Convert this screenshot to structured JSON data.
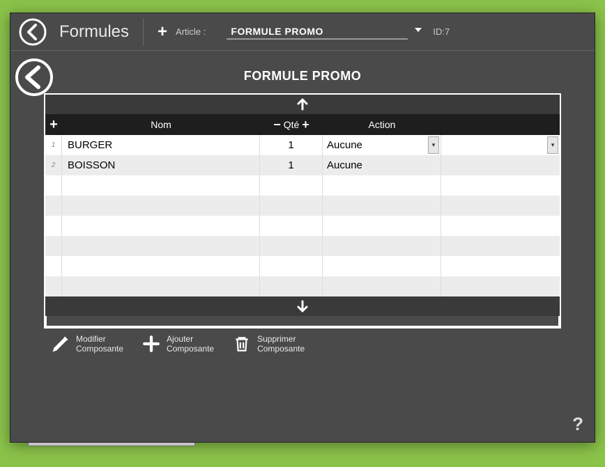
{
  "header": {
    "title": "Formules",
    "article_label": "Article :",
    "article_value": "FORMULE PROMO",
    "id_label": "ID:7"
  },
  "body": {
    "title": "FORMULE PROMO",
    "columns": {
      "nom": "Nom",
      "qte": "Qté",
      "action": "Action"
    },
    "rows": [
      {
        "idx": "1",
        "nom": "BURGER",
        "qte": "1",
        "action": "Aucune"
      },
      {
        "idx": "2",
        "nom": "BOISSON",
        "qte": "1",
        "action": "Aucune"
      }
    ]
  },
  "footer": {
    "modifier_l1": "Modifier",
    "modifier_l2": "Composante",
    "ajouter_l1": "Ajouter",
    "ajouter_l2": "Composante",
    "supprimer_l1": "Supprimer",
    "supprimer_l2": "Composante"
  },
  "help": "?"
}
